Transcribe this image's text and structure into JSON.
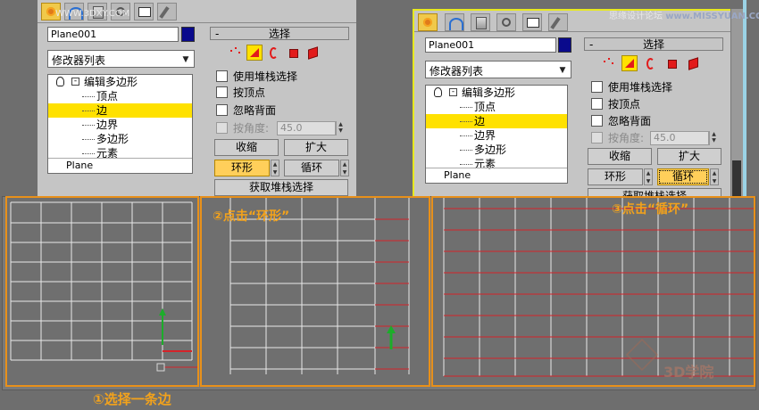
{
  "watermarks": {
    "top_left": "WWW.3DXY.COM",
    "top_right": "思缘设计论坛",
    "top_right_site": "www.MISSYUAN.COM",
    "bottom_right": "3D学院"
  },
  "panel_left": {
    "object_name": "Plane001",
    "modifier_list": "修改器列表",
    "tree": {
      "root": "编辑多边形",
      "items": [
        "顶点",
        "边",
        "边界",
        "多边形",
        "元素"
      ],
      "selected_index": 1,
      "base": "Plane"
    },
    "selection": {
      "title": "选择",
      "use_stack": "使用堆栈选择",
      "by_vertex": "按顶点",
      "ignore_back": "忽略背面",
      "by_angle": "按角度:",
      "angle_value": "45.0",
      "shrink": "收缩",
      "grow": "扩大",
      "ring": "环形",
      "loop": "循环",
      "get_stack": "获取堆栈选择"
    }
  },
  "panel_right": {
    "object_name": "Plane001",
    "modifier_list": "修改器列表",
    "tree": {
      "root": "编辑多边形",
      "items": [
        "顶点",
        "边",
        "边界",
        "多边形",
        "元素"
      ],
      "selected_index": 1,
      "base": "Plane"
    },
    "selection": {
      "title": "选择",
      "use_stack": "使用堆栈选择",
      "by_vertex": "按顶点",
      "ignore_back": "忽略背面",
      "by_angle": "按角度:",
      "angle_value": "45.0",
      "shrink": "收缩",
      "grow": "扩大",
      "ring": "环形",
      "loop": "循环",
      "get_stack": "获取堆栈选择"
    }
  },
  "steps": {
    "step1": "①选择一条边",
    "step2": "②点击“环形”",
    "step3": "③点击“循环”"
  },
  "colors": {
    "highlight": "#ffe100",
    "step_caption": "#f2a21c",
    "edge_selected": "#d5232a",
    "swatch": "#0a0a8c"
  }
}
